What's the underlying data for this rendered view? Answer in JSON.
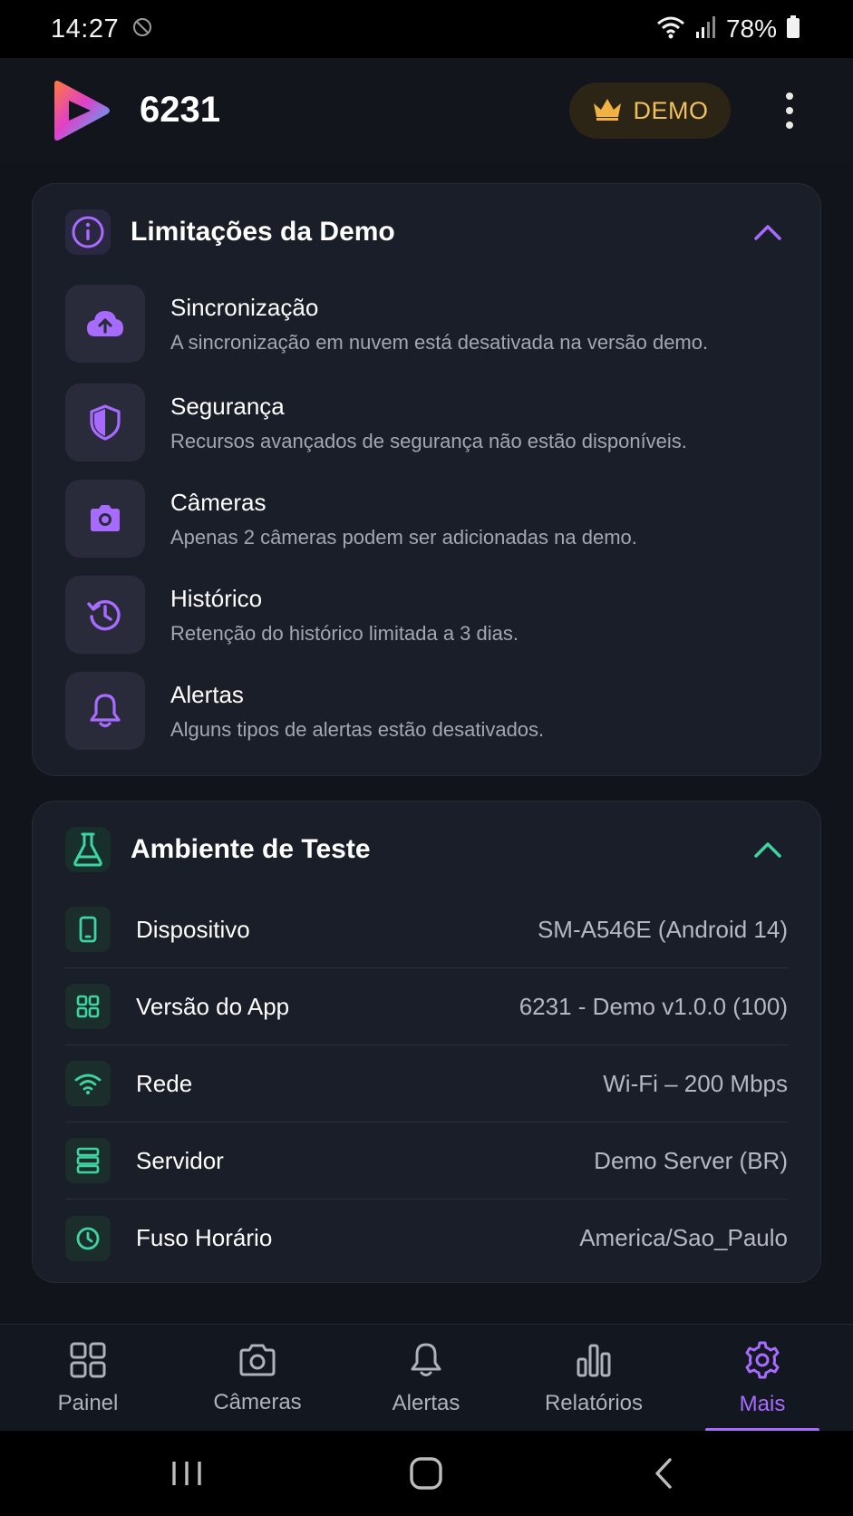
{
  "status_bar": {
    "time": "14:27",
    "battery": "78%"
  },
  "header": {
    "title": "6231",
    "badge_label": "DEMO",
    "accent_color": "#f0c05a"
  },
  "limits_card": {
    "title": "Limitações da Demo",
    "accent_color": "#a86bff",
    "items": [
      {
        "icon": "cloud-upload-icon",
        "title": "Sincronização",
        "description": "A sincronização em nuvem está desativada na versão demo."
      },
      {
        "icon": "shield-icon",
        "title": "Segurança",
        "description": "Recursos avançados de segurança não estão disponíveis."
      },
      {
        "icon": "camera-icon",
        "title": "Câmeras",
        "description": "Apenas 2 câmeras podem ser adicionadas na demo."
      },
      {
        "icon": "history-icon",
        "title": "Histórico",
        "description": "Retenção do histórico limitada a 3 dias."
      },
      {
        "icon": "bell-icon",
        "title": "Alertas",
        "description": "Alguns tipos de alertas estão desativados."
      }
    ]
  },
  "env_card": {
    "title": "Ambiente de Teste",
    "accent_color": "#3ed4a0",
    "rows": [
      {
        "icon": "phone-icon",
        "label": "Dispositivo",
        "value": "SM-A546E (Android 14)"
      },
      {
        "icon": "apps-grid-icon",
        "label": "Versão do App",
        "value": "6231 - Demo v1.0.0 (100)"
      },
      {
        "icon": "wifi-icon",
        "label": "Rede",
        "value": "Wi-Fi – 200 Mbps"
      },
      {
        "icon": "server-icon",
        "label": "Servidor",
        "value": "Demo Server (BR)"
      },
      {
        "icon": "clock-icon",
        "label": "Fuso Horário",
        "value": "America/Sao_Paulo"
      }
    ]
  },
  "bottom_nav": {
    "items": [
      {
        "icon": "dashboard-icon",
        "label": "Painel",
        "active": false
      },
      {
        "icon": "camera-icon",
        "label": "Câmeras",
        "active": false
      },
      {
        "icon": "bell-icon",
        "label": "Alertas",
        "active": false
      },
      {
        "icon": "bar-chart-icon",
        "label": "Relatórios",
        "active": false
      },
      {
        "icon": "gear-icon",
        "label": "Mais",
        "active": true
      }
    ],
    "active_color": "#a86bff"
  }
}
